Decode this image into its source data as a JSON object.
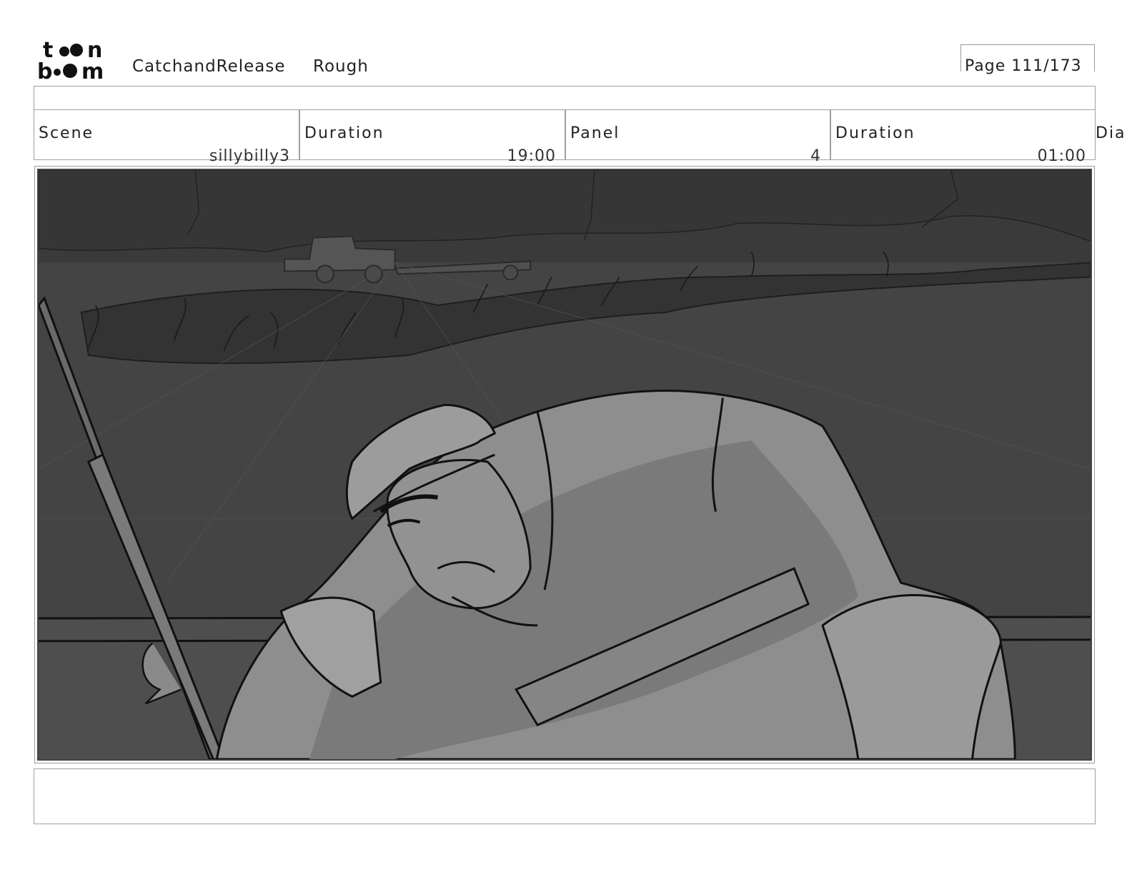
{
  "header": {
    "logo_text": "toonboom",
    "project": "CatchandRelease",
    "stage": "Rough",
    "page": "Page 111/173"
  },
  "info": {
    "scene_label": "Scene",
    "scene_value": "sillybilly3",
    "scene_duration_label": "Duration",
    "scene_duration_value": "19:00",
    "panel_label": "Panel",
    "panel_value": "4",
    "panel_duration_label": "Duration",
    "panel_duration_value": "01:00",
    "dialogue_label": "Dia"
  },
  "panel_image": {
    "subject": "grumpy fisherman in bucket hat leaning over boat edge, fishing rod on left, pickup truck with trailer on far shore",
    "background_color": "#3d3d3d"
  },
  "notes": {
    "text": ""
  }
}
